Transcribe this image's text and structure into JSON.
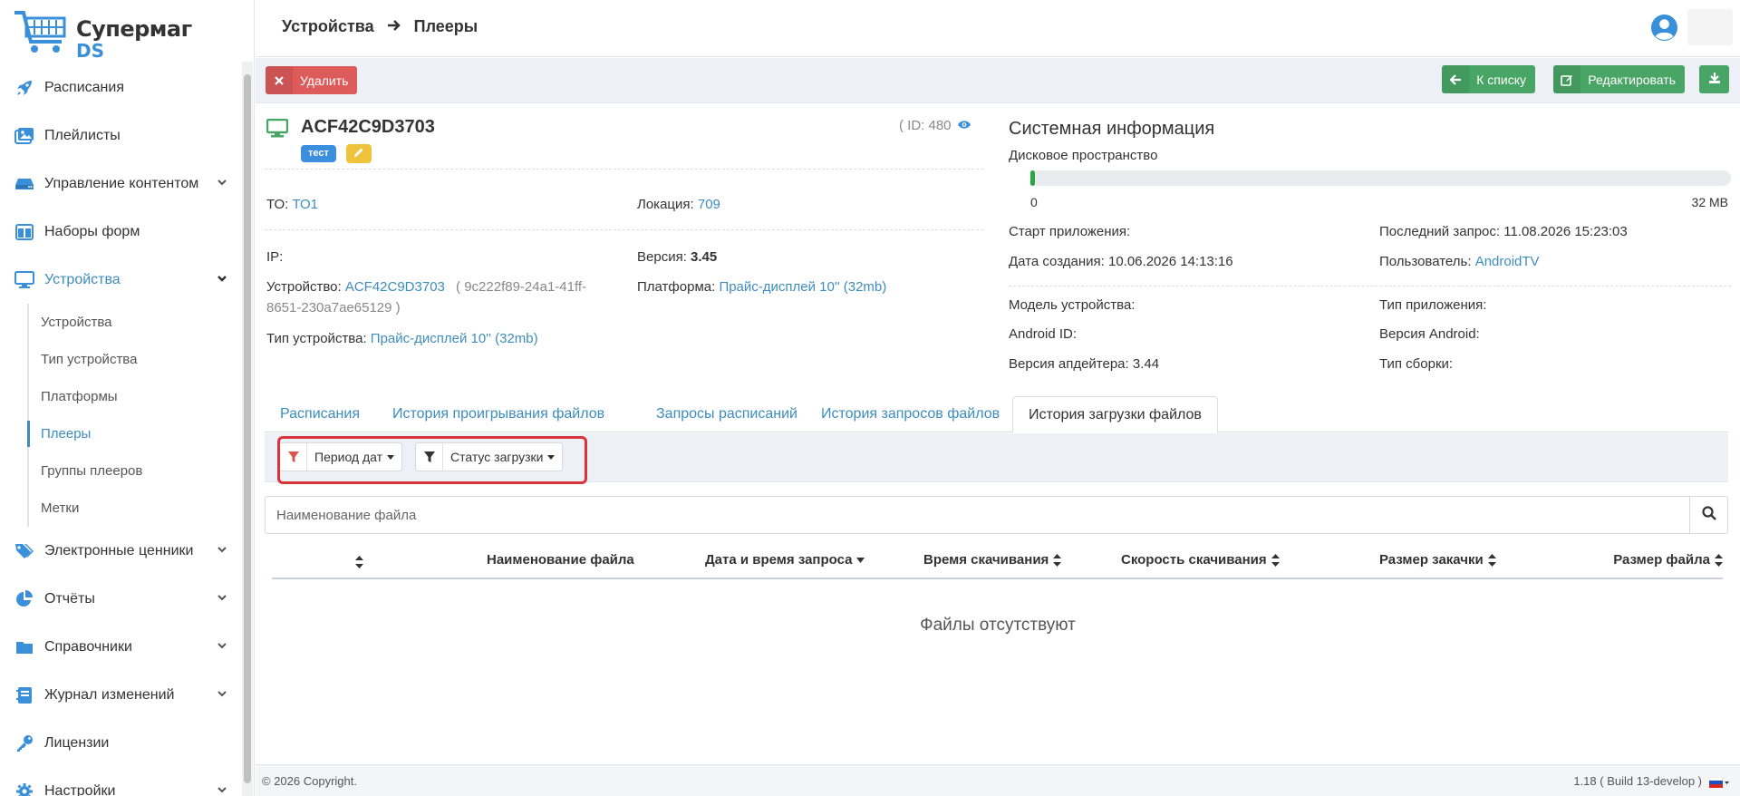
{
  "brand": {
    "line1": "Супермаг",
    "line2": "DS"
  },
  "sidebar": {
    "items": [
      {
        "label": "Расписания",
        "icon": "rocket-icon"
      },
      {
        "label": "Плейлисты",
        "icon": "images-icon"
      },
      {
        "label": "Управление контентом",
        "icon": "hdd-icon",
        "expandable": true
      },
      {
        "label": "Наборы форм",
        "icon": "columns-icon"
      },
      {
        "label": "Устройства",
        "icon": "desktop-icon",
        "expandable": true,
        "active": true
      },
      {
        "label": "Электронные ценники",
        "icon": "tags-icon",
        "expandable": true
      },
      {
        "label": "Отчёты",
        "icon": "pie-chart-icon",
        "expandable": true
      },
      {
        "label": "Справочники",
        "icon": "folder-icon",
        "expandable": true
      },
      {
        "label": "Журнал изменений",
        "icon": "journal-icon",
        "expandable": true
      },
      {
        "label": "Лицензии",
        "icon": "key-icon"
      },
      {
        "label": "Настройки",
        "icon": "gear-icon",
        "expandable": true
      }
    ],
    "subitems": [
      "Устройства",
      "Тип устройства",
      "Платформы",
      "Плееры",
      "Группы плееров",
      "Метки"
    ],
    "active_sub": "Плееры"
  },
  "header": {
    "crumb1": "Устройства",
    "crumb2": "Плееры"
  },
  "toolbar": {
    "delete": "Удалить",
    "to_list": "К списку",
    "edit": "Редактировать"
  },
  "device": {
    "name": "ACF42C9D3703",
    "tag": "тест",
    "id_text": "( ID: 480",
    "to_label": "ТО:",
    "to_value": "ТО1",
    "location_label": "Локация:",
    "location_value": "709",
    "ip_label": "IP:",
    "version_label": "Версия:",
    "version_value": "3.45",
    "device_label": "Устройство:",
    "device_value": "ACF42C9D3703",
    "device_uuid_1": "( 9c222f89-24a1-41ff-",
    "device_uuid_2": "8651-230a7ae65129 )",
    "platform_label": "Платформа:",
    "platform_value": "Прайс-дисплей 10'' (32mb)",
    "type_label": "Тип устройства:",
    "type_value": "Прайс-дисплей 10'' (32mb)"
  },
  "system": {
    "title": "Системная информация",
    "disk_label": "Дисковое пространство",
    "disk_min": "0",
    "disk_max": "32 MB",
    "disk_used_fraction": 0.002,
    "app_start": "Старт приложения:",
    "last_request": "Последний запрос: 11.08.2026 15:23:03",
    "created": "Дата создания: 10.06.2026 14:13:16",
    "user_label": "Пользователь:",
    "user_value": "AndroidTV",
    "model": "Модель устройства:",
    "app_type": "Тип приложения:",
    "android_id": "Android ID:",
    "android_version": "Версия Android:",
    "updater_version": "Версия апдейтера: 3.44",
    "build_type": "Тип сборки:"
  },
  "tabs": [
    "Расписания",
    "История проигрывания файлов",
    "Запросы расписаний",
    "История запросов файлов",
    "История загрузки файлов"
  ],
  "active_tab": "История загрузки файлов",
  "filters": {
    "period": "Период дат",
    "status": "Статус загрузки"
  },
  "search": {
    "placeholder": "Наименование файла",
    "value": ""
  },
  "table": {
    "columns": [
      "Наименование файла",
      "Дата и время запроса",
      "Время скачивания",
      "Скорость скачивания",
      "Размер закачки",
      "Размер файла"
    ],
    "empty": "Файлы отсутствуют"
  },
  "footer": {
    "copyright": "© 2026 Copyright.",
    "build": "1.18 ( Build 13-develop )"
  },
  "colors": {
    "accent": "#3c8dbc",
    "success": "#49a566",
    "danger": "#dd5b5b",
    "warning": "#f0c33c",
    "highlight": "#d9343b"
  }
}
